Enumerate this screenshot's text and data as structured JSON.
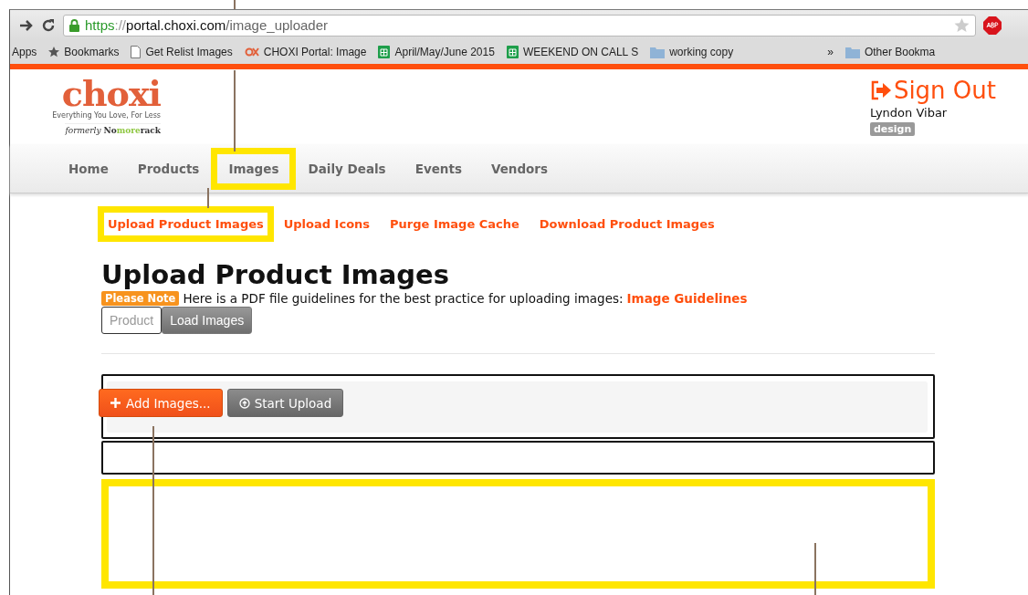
{
  "browser": {
    "url": {
      "scheme": "https",
      "separator": "://",
      "host": "portal.choxi.com",
      "path": "/image_uploader"
    },
    "bookmarks": [
      {
        "kind": "apps",
        "label": "Apps"
      },
      {
        "kind": "star",
        "label": "Bookmarks"
      },
      {
        "kind": "page",
        "label": "Get Relist Images"
      },
      {
        "kind": "site",
        "label": "CHOXI Portal: Image"
      },
      {
        "kind": "sheet",
        "label": "April/May/June 2015"
      },
      {
        "kind": "sheet",
        "label": "WEEKEND ON CALL S"
      },
      {
        "kind": "folder",
        "label": "working copy"
      }
    ],
    "overflow": "»",
    "other": "Other Bookma"
  },
  "header": {
    "logo": "choxi",
    "tagline": "Everything You Love, For Less",
    "formerly": "formerly",
    "former_brand": [
      "No",
      "more",
      "rack"
    ],
    "sign_out": "Sign Out",
    "user": "Lyndon Vibar",
    "role": "design"
  },
  "nav": [
    {
      "label": "Home",
      "highlighted": false
    },
    {
      "label": "Products",
      "highlighted": false
    },
    {
      "label": "Images",
      "highlighted": true
    },
    {
      "label": "Daily Deals",
      "highlighted": false
    },
    {
      "label": "Events",
      "highlighted": false
    },
    {
      "label": "Vendors",
      "highlighted": false
    }
  ],
  "subnav": [
    {
      "label": "Upload Product Images",
      "highlighted": true
    },
    {
      "label": "Upload Icons",
      "highlighted": false
    },
    {
      "label": "Purge Image Cache",
      "highlighted": false
    },
    {
      "label": "Download Product Images",
      "highlighted": false
    }
  ],
  "title": "Upload Product Images",
  "note": {
    "badge": "Please Note",
    "text": "Here is a PDF file guidelines for the best practice for uploading images:",
    "link": "Image Guidelines"
  },
  "toggle": [
    {
      "label": "Product",
      "selected": false
    },
    {
      "label": "Load Images",
      "selected": true
    }
  ],
  "uploader": {
    "add": "Add Images...",
    "start": "Start Upload",
    "drop_zone_highlighted": true
  }
}
